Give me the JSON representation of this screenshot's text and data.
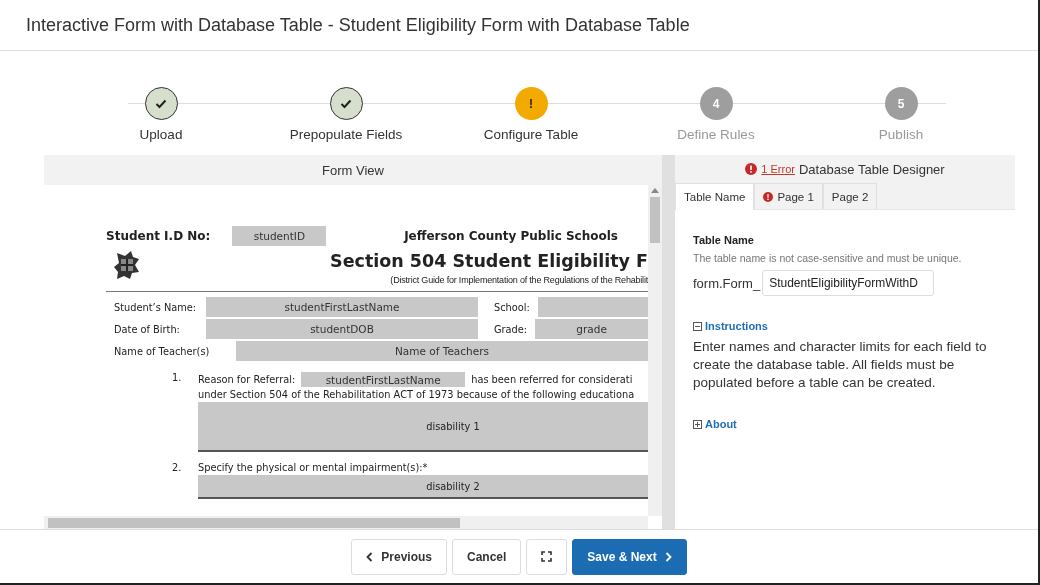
{
  "window": {
    "title": "Interactive Form with Database Table - Student Eligibility Form with Database Table"
  },
  "steps": [
    {
      "label": "Upload",
      "kind": "done"
    },
    {
      "label": "Prepopulate Fields",
      "kind": "done"
    },
    {
      "label": "Configure Table",
      "kind": "warning",
      "symbol": "!"
    },
    {
      "label": "Define Rules",
      "kind": "pending",
      "number": "4"
    },
    {
      "label": "Publish",
      "kind": "pending",
      "number": "5"
    }
  ],
  "form_view": {
    "title": "Form View",
    "document": {
      "id_label": "Student I.D No:",
      "id_value": "studentID",
      "district": "Jefferson County Public Schools",
      "heading": "Section 504 Student Eligibility F",
      "subheading": "(District Guide for Implementation of the Regulations of the Rehabilit",
      "rows": [
        [
          {
            "label": "Student’s Name:",
            "value": "studentFirstLastName"
          },
          {
            "label": "School:"
          }
        ],
        [
          {
            "label": "Date of Birth:",
            "value": "studentDOB"
          },
          {
            "label": "Grade:",
            "value": "grade"
          }
        ],
        [
          {
            "label": "Name of Teacher(s)",
            "value": "Name of Teachers"
          }
        ]
      ],
      "items": [
        {
          "number": "1.",
          "lead": "Reason for Referral:",
          "field": "studentFirstLastName",
          "rest": "has been referred for considerati",
          "line2": "under Section 504 of the Rehabilitation ACT of 1973 because of the following educationa",
          "area": "disability 1"
        },
        {
          "number": "2.",
          "lead": "Specify the physical or mental impairment(s):*",
          "area": "disability 2"
        }
      ]
    }
  },
  "designer": {
    "error_link": "1 Error",
    "title": "Database Table Designer",
    "tabs": [
      {
        "label": "Table Name",
        "selected": true,
        "error": false
      },
      {
        "label": "Page 1",
        "selected": false,
        "error": true
      },
      {
        "label": "Page 2",
        "selected": false,
        "error": false
      }
    ],
    "section_title": "Table Name",
    "hint": "The table name is not case-sensitive and must be unique.",
    "prefix": "form.Form_",
    "table_name": "StudentEligibilityFormWithD",
    "sections": [
      {
        "label": "Instructions",
        "expanded": true,
        "text": "Enter names and character limits for each field to create the database table. All fields must be populated before a table can be created."
      },
      {
        "label": "About",
        "expanded": false
      }
    ]
  },
  "footer": {
    "buttons": [
      {
        "kind": "previous",
        "label": "Previous"
      },
      {
        "kind": "cancel",
        "label": "Cancel"
      },
      {
        "kind": "fullscreen"
      },
      {
        "kind": "next",
        "label": "Save & Next"
      }
    ]
  }
}
